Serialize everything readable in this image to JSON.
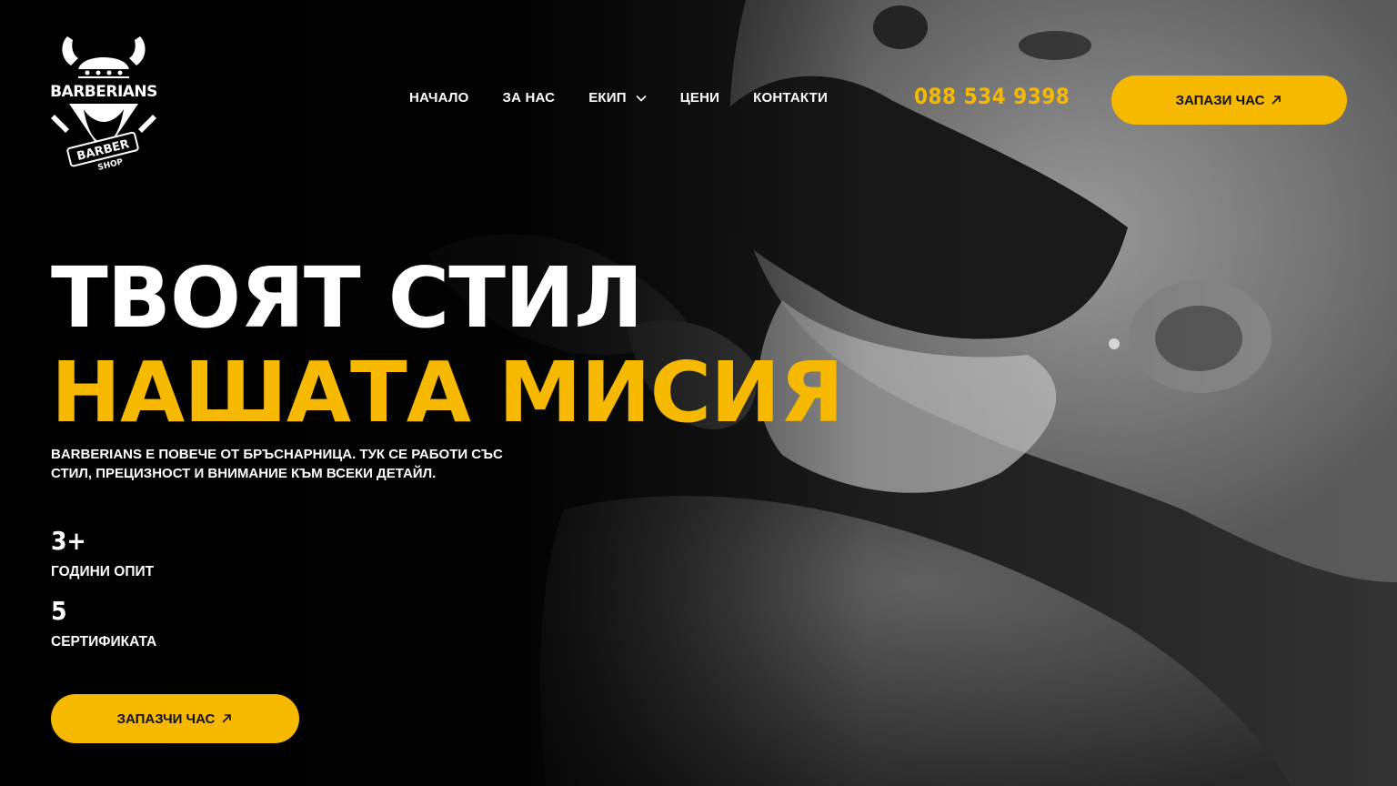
{
  "logo": {
    "brand": "BARBERIANS",
    "badge_line1": "BARBER",
    "badge_line2": "SHOP"
  },
  "nav": {
    "items": [
      {
        "label": "НАЧАЛО"
      },
      {
        "label": "ЗА НАС"
      },
      {
        "label": "ЕКИП",
        "has_dropdown": true
      },
      {
        "label": "ЦЕНИ"
      },
      {
        "label": "КОНТАКТИ"
      }
    ]
  },
  "header": {
    "phone": "088 534 9398",
    "cta_label": "ЗАПАЗИ ЧАС"
  },
  "hero": {
    "headline_line1": "ТВОЯТ СТИЛ",
    "headline_line2": "НАШАТА МИСИЯ",
    "lead_line1": "BARBERIANS Е ПОВЕЧЕ ОТ БРЪСНАРНИЦА. ТУК СЕ РАБОТИ СЪС",
    "lead_line2": "СТИЛ, ПРЕЦИЗНОСТ И ВНИМАНИЕ КЪМ ВСЕКИ ДЕТАЙЛ.",
    "stats": [
      {
        "value": "3+",
        "label": "ГОДИНИ ОПИТ"
      },
      {
        "value": "5",
        "label": "СЕРТИФИКАТА"
      }
    ],
    "cta_label": "ЗАПАЗЧИ ЧАС"
  },
  "colors": {
    "accent": "#f7b800",
    "background": "#000000",
    "text": "#ffffff"
  }
}
